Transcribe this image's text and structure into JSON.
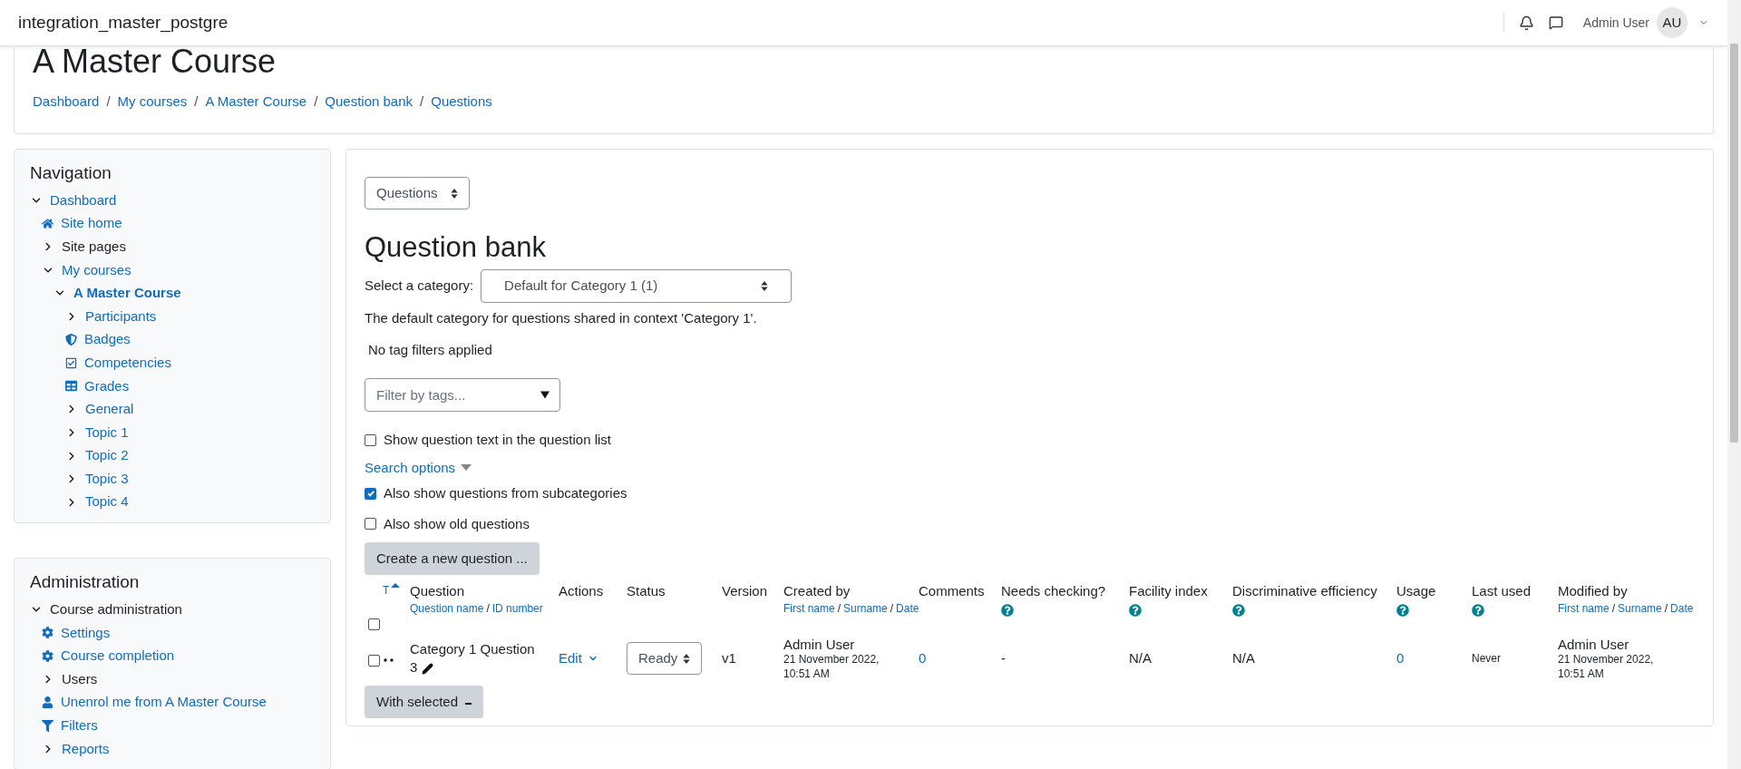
{
  "navbar": {
    "site_name": "integration_master_postgre",
    "user_name": "Admin User",
    "avatar_initials": "AU"
  },
  "course_header": {
    "title": "A Master Course",
    "breadcrumbs": [
      "Dashboard",
      "My courses",
      "A Master Course",
      "Question bank",
      "Questions"
    ],
    "separator": "/"
  },
  "navigation": {
    "title": "Navigation",
    "items": [
      {
        "label": "Dashboard",
        "kind": "branch",
        "expanded": true,
        "link": true,
        "current": false,
        "children": [
          {
            "label": "Site home",
            "kind": "home",
            "link": true,
            "current": false
          },
          {
            "label": "Site pages",
            "kind": "branch",
            "expanded": false,
            "link": false,
            "current": false
          },
          {
            "label": "My courses",
            "kind": "branch",
            "expanded": true,
            "link": true,
            "current": false,
            "children": [
              {
                "label": "A Master Course",
                "kind": "branch",
                "expanded": true,
                "link": true,
                "current": true,
                "children": [
                  {
                    "label": "Participants",
                    "kind": "branch",
                    "expanded": false,
                    "link": true,
                    "current": false
                  },
                  {
                    "label": "Badges",
                    "kind": "shield",
                    "link": true,
                    "current": false
                  },
                  {
                    "label": "Competencies",
                    "kind": "checklist",
                    "link": true,
                    "current": false
                  },
                  {
                    "label": "Grades",
                    "kind": "grid",
                    "link": true,
                    "current": false
                  },
                  {
                    "label": "General",
                    "kind": "branch",
                    "expanded": false,
                    "link": true,
                    "current": false
                  },
                  {
                    "label": "Topic 1",
                    "kind": "branch",
                    "expanded": false,
                    "link": true,
                    "current": false
                  },
                  {
                    "label": "Topic 2",
                    "kind": "branch",
                    "expanded": false,
                    "link": true,
                    "current": false
                  },
                  {
                    "label": "Topic 3",
                    "kind": "branch",
                    "expanded": false,
                    "link": true,
                    "current": false
                  },
                  {
                    "label": "Topic 4",
                    "kind": "branch",
                    "expanded": false,
                    "link": true,
                    "current": false
                  }
                ]
              }
            ]
          }
        ]
      }
    ]
  },
  "administration": {
    "title": "Administration",
    "items": [
      {
        "label": "Course administration",
        "kind": "branch",
        "expanded": true,
        "link": false,
        "current": false,
        "children": [
          {
            "label": "Settings",
            "kind": "gear",
            "link": true,
            "current": false
          },
          {
            "label": "Course completion",
            "kind": "gear",
            "link": true,
            "current": false
          },
          {
            "label": "Users",
            "kind": "branch",
            "expanded": false,
            "link": false,
            "current": false
          },
          {
            "label": "Unenrol me from A Master Course",
            "kind": "user",
            "link": true,
            "current": false
          },
          {
            "label": "Filters",
            "kind": "filter",
            "link": true,
            "current": false
          },
          {
            "label": "Reports",
            "kind": "branch",
            "expanded": false,
            "link": true,
            "current": false
          }
        ]
      }
    ]
  },
  "question_bank": {
    "page_select": "Questions",
    "title": "Question bank",
    "category_label": "Select a category:",
    "category_value": "Default for Category 1 (1)",
    "category_info": "The default category for questions shared in context 'Category 1'.",
    "tag_status": "No tag filters applied",
    "tag_filter": {
      "placeholder": "Filter by tags..."
    },
    "options": [
      {
        "label": "Show question text in the question list",
        "checked": false
      }
    ],
    "search_options": "Search options",
    "search_checks": [
      {
        "label": "Also show questions from subcategories",
        "checked": true
      },
      {
        "label": "Also show old questions",
        "checked": false
      }
    ],
    "create_button": "Create a new question ...",
    "table": {
      "type_sort": "T",
      "select_all_checked": false,
      "sort_separator": "/",
      "columns": [
        {
          "label": "Question",
          "sort_links": [
            "Question name",
            "ID number"
          ]
        },
        {
          "label": "Actions"
        },
        {
          "label": "Status"
        },
        {
          "label": "Version"
        },
        {
          "label": "Created by",
          "sort_links": [
            "First name",
            "Surname",
            "Date"
          ]
        },
        {
          "label": "Comments"
        },
        {
          "label": "Needs checking?",
          "help": true
        },
        {
          "label": "Facility index",
          "help": true
        },
        {
          "label": "Discriminative efficiency",
          "help": true
        },
        {
          "label": "Usage",
          "help": true
        },
        {
          "label": "Last used",
          "help": true
        },
        {
          "label": "Modified by",
          "sort_links": [
            "First name",
            "Surname",
            "Date"
          ]
        }
      ],
      "rows": [
        {
          "checked": false,
          "name": "Category 1 Question 3",
          "action": "Edit",
          "status": "Ready",
          "version": "v1",
          "created_by": {
            "name": "Admin User",
            "date": "21 November 2022, 10:51 AM"
          },
          "comments": "0",
          "needs_checking": "-",
          "facility_index": "N/A",
          "discriminative_efficiency": "N/A",
          "usage": "0",
          "last_used": "Never",
          "modified_by": {
            "name": "Admin User",
            "date": "21 November 2022, 10:51 AM"
          }
        }
      ]
    },
    "with_selected": "With selected"
  }
}
